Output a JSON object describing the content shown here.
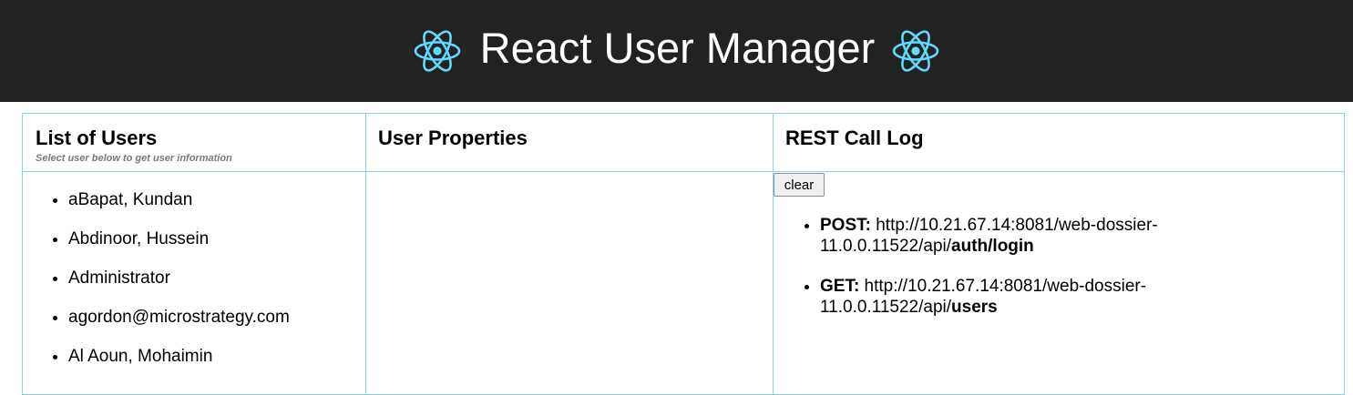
{
  "header": {
    "title": "React User Manager",
    "logo_icon": "react-atom-icon",
    "background": "#222222",
    "logo_color": "#61dafb"
  },
  "columns": {
    "users": {
      "title": "List of Users",
      "subtitle": "Select user below to get user information",
      "items": [
        "aBapat, Kundan",
        "Abdinoor, Hussein",
        "Administrator",
        "agordon@microstrategy.com",
        "Al Aoun, Mohaimin"
      ]
    },
    "properties": {
      "title": "User Properties"
    },
    "log": {
      "title": "REST Call Log",
      "clear_label": "clear",
      "entries": [
        {
          "method": "POST:",
          "url_prefix": " http://10.21.67.14:8081/web-dossier-11.0.0.11522/api/",
          "endpoint": "auth/login"
        },
        {
          "method": "GET:",
          "url_prefix": " http://10.21.67.14:8081/web-dossier-11.0.0.11522/api/",
          "endpoint": "users"
        }
      ]
    }
  },
  "border_color": "#87d5e6"
}
